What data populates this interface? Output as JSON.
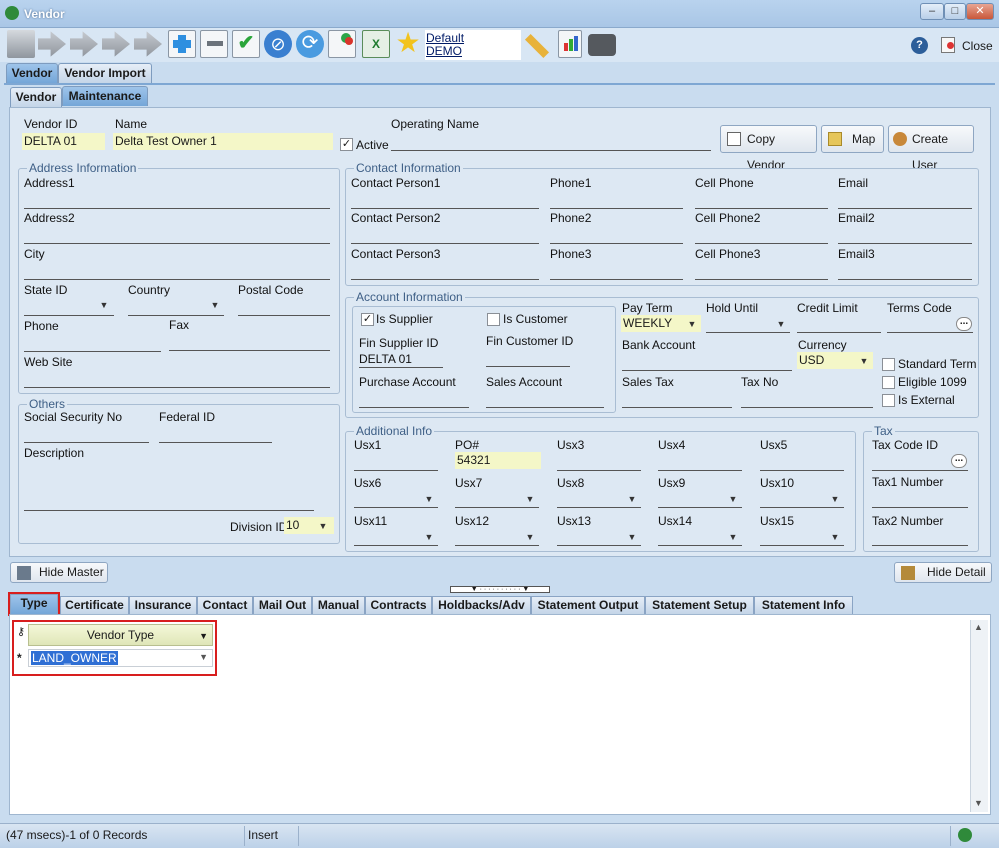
{
  "window": {
    "title": "Vendor",
    "minimize": "‒",
    "maximize": "□",
    "close": "✕"
  },
  "toolbar": {
    "profile_line1": "Default",
    "profile_line2": "DEMO",
    "close_label": "Close",
    "icons": [
      "save-icon",
      "first-icon",
      "prev-icon",
      "next-icon",
      "last-icon",
      "add-icon",
      "delete-icon",
      "approve-icon",
      "cancel-icon",
      "refresh-icon",
      "copy-record-icon",
      "excel-icon",
      "favorite-icon",
      "edit-icon",
      "report-icon",
      "camera-icon",
      "help-icon"
    ]
  },
  "tabs_top": [
    "Vendor",
    "Vendor Import"
  ],
  "tabs_sub": [
    "Vendor",
    "Maintenance"
  ],
  "header": {
    "vendor_id_label": "Vendor ID",
    "vendor_id": "DELTA 01",
    "name_label": "Name",
    "name": "Delta Test Owner 1",
    "active_label": "Active",
    "active_checked": true,
    "operating_name_label": "Operating Name",
    "copy_vendor": "Copy Vendor",
    "map": "Map",
    "create_user": "Create User"
  },
  "address": {
    "title": "Address Information",
    "address1": "Address1",
    "address2": "Address2",
    "city": "City",
    "state": "State ID",
    "country": "Country",
    "postal": "Postal Code",
    "phone": "Phone",
    "fax": "Fax",
    "website": "Web Site"
  },
  "contact": {
    "title": "Contact Information",
    "labels": [
      [
        "Contact Person1",
        "Phone1",
        "Cell Phone",
        "Email"
      ],
      [
        "Contact Person2",
        "Phone2",
        "Cell Phone2",
        "Email2"
      ],
      [
        "Contact Person3",
        "Phone3",
        "Cell Phone3",
        "Email3"
      ]
    ]
  },
  "account": {
    "title": "Account Information",
    "is_supplier": "Is Supplier",
    "is_customer": "Is Customer",
    "fin_supplier_label": "Fin Supplier ID",
    "fin_supplier": "DELTA 01",
    "fin_customer_label": "Fin Customer ID",
    "purchase_account": "Purchase Account",
    "sales_account": "Sales Account",
    "pay_term_label": "Pay Term",
    "pay_term": "WEEKLY",
    "hold_until": "Hold Until",
    "credit_limit": "Credit Limit",
    "terms_code": "Terms Code",
    "bank_account": "Bank Account",
    "currency_label": "Currency",
    "currency": "USD",
    "sales_tax": "Sales Tax",
    "tax_no": "Tax No",
    "standard_term": "Standard Term",
    "eligible_1099": "Eligible 1099",
    "is_external": "Is External"
  },
  "others": {
    "title": "Others",
    "ssn": "Social Security No",
    "federal_id": "Federal  ID",
    "description": "Description",
    "division_label": "Division ID",
    "division": "10"
  },
  "additional": {
    "title": "Additional Info",
    "rows": [
      [
        "Usx1",
        "PO#",
        "Usx3",
        "Usx4",
        "Usx5"
      ],
      [
        "Usx6",
        "Usx7",
        "Usx8",
        "Usx9",
        "Usx10"
      ],
      [
        "Usx11",
        "Usx12",
        "Usx13",
        "Usx14",
        "Usx15"
      ]
    ],
    "po_value": "54321"
  },
  "tax": {
    "title": "Tax",
    "tax_code": "Tax Code ID",
    "tax1": "Tax1 Number",
    "tax2": "Tax2 Number"
  },
  "detail": {
    "hide_master": "Hide Master",
    "hide_detail": "Hide Detail",
    "tabs": [
      "Type",
      "Certificate",
      "Insurance",
      "Contact",
      "Mail Out",
      "Manual",
      "Contracts",
      "Holdbacks/Adv",
      "Statement Output",
      "Statement Setup",
      "Statement Info"
    ],
    "grid_header": "Vendor Type",
    "new_row_marker": "*",
    "grid_value": "LAND_OWNER"
  },
  "status": {
    "records": "(47 msecs)-1 of 0 Records",
    "mode": "Insert"
  }
}
